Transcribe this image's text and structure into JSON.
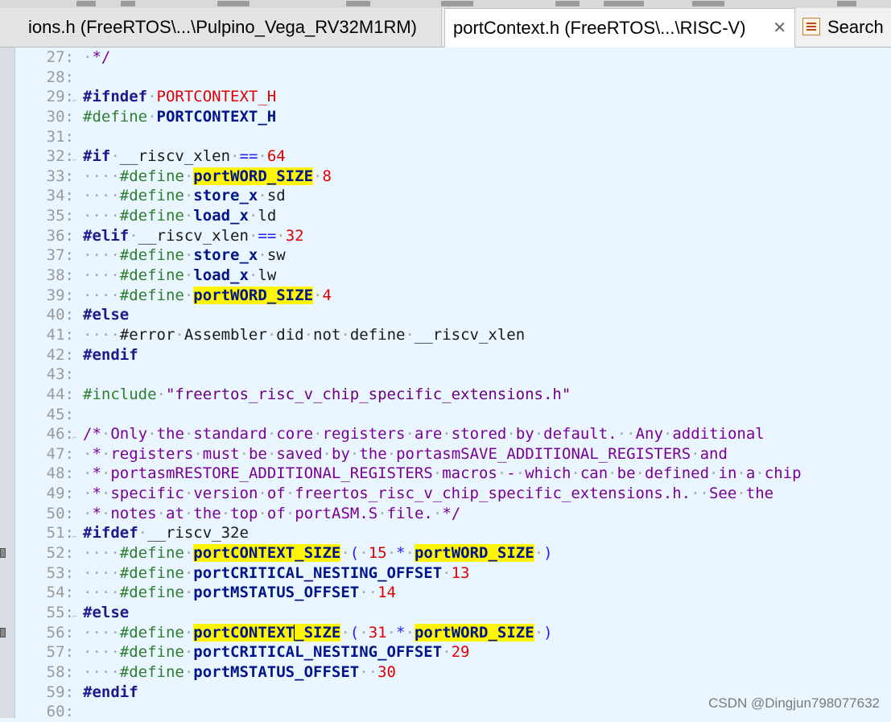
{
  "tabs": {
    "left_title": "ions.h (FreeRTOS\\...\\Pulpino_Vega_RV32M1RM)",
    "active_title": "portContext.h (FreeRTOS\\...\\RISC-V)",
    "close_glyph": "✕",
    "search_label": "Search"
  },
  "lines": [
    {
      "n": "27:",
      "segs": [
        [
          "dot",
          "·"
        ],
        [
          "cmt",
          "*/"
        ]
      ]
    },
    {
      "n": "28:",
      "segs": []
    },
    {
      "n": "29:",
      "fold": true,
      "segs": [
        [
          "pp",
          "#ifndef"
        ],
        [
          "dot",
          "·"
        ],
        [
          "red",
          "PORTCONTEXT_H"
        ]
      ]
    },
    {
      "n": "30:",
      "segs": [
        [
          "def",
          "#define"
        ],
        [
          "dot",
          "·"
        ],
        [
          "mac",
          "PORTCONTEXT_H"
        ]
      ]
    },
    {
      "n": "31:",
      "segs": []
    },
    {
      "n": "32:",
      "fold": true,
      "segs": [
        [
          "pp",
          "#if"
        ],
        [
          "dot",
          "·"
        ],
        [
          "plain",
          "__riscv_xlen"
        ],
        [
          "dot",
          "·"
        ],
        [
          "op",
          "=="
        ],
        [
          "dot",
          "·"
        ],
        [
          "num",
          "64"
        ]
      ]
    },
    {
      "n": "33:",
      "segs": [
        [
          "dot",
          "····"
        ],
        [
          "def",
          "#define"
        ],
        [
          "dot",
          "·"
        ],
        [
          "mac hl",
          "portWORD_SIZE"
        ],
        [
          "dot",
          "·"
        ],
        [
          "num",
          "8"
        ]
      ]
    },
    {
      "n": "34:",
      "segs": [
        [
          "dot",
          "····"
        ],
        [
          "def",
          "#define"
        ],
        [
          "dot",
          "·"
        ],
        [
          "mac",
          "store_x"
        ],
        [
          "dot",
          "·"
        ],
        [
          "plain",
          "sd"
        ]
      ]
    },
    {
      "n": "35:",
      "segs": [
        [
          "dot",
          "····"
        ],
        [
          "def",
          "#define"
        ],
        [
          "dot",
          "·"
        ],
        [
          "mac",
          "load_x"
        ],
        [
          "dot",
          "·"
        ],
        [
          "plain",
          "ld"
        ]
      ]
    },
    {
      "n": "36:",
      "segs": [
        [
          "pp",
          "#elif"
        ],
        [
          "dot",
          "·"
        ],
        [
          "plain",
          "__riscv_xlen"
        ],
        [
          "dot",
          "·"
        ],
        [
          "op",
          "=="
        ],
        [
          "dot",
          "·"
        ],
        [
          "num",
          "32"
        ]
      ]
    },
    {
      "n": "37:",
      "segs": [
        [
          "dot",
          "····"
        ],
        [
          "def",
          "#define"
        ],
        [
          "dot",
          "·"
        ],
        [
          "mac",
          "store_x"
        ],
        [
          "dot",
          "·"
        ],
        [
          "plain",
          "sw"
        ]
      ]
    },
    {
      "n": "38:",
      "segs": [
        [
          "dot",
          "····"
        ],
        [
          "def",
          "#define"
        ],
        [
          "dot",
          "·"
        ],
        [
          "mac",
          "load_x"
        ],
        [
          "dot",
          "·"
        ],
        [
          "plain",
          "lw"
        ]
      ]
    },
    {
      "n": "39:",
      "segs": [
        [
          "dot",
          "····"
        ],
        [
          "def",
          "#define"
        ],
        [
          "dot",
          "·"
        ],
        [
          "mac hl",
          "portWORD_SIZE"
        ],
        [
          "dot",
          "·"
        ],
        [
          "num",
          "4"
        ]
      ]
    },
    {
      "n": "40:",
      "segs": [
        [
          "pp",
          "#else"
        ]
      ]
    },
    {
      "n": "41:",
      "segs": [
        [
          "dot",
          "····"
        ],
        [
          "plain",
          "#error"
        ],
        [
          "dot",
          "·"
        ],
        [
          "plain",
          "Assembler"
        ],
        [
          "dot",
          "·"
        ],
        [
          "plain",
          "did"
        ],
        [
          "dot",
          "·"
        ],
        [
          "plain",
          "not"
        ],
        [
          "dot",
          "·"
        ],
        [
          "plain",
          "define"
        ],
        [
          "dot",
          "·"
        ],
        [
          "plain",
          "__riscv_xlen"
        ]
      ]
    },
    {
      "n": "42:",
      "segs": [
        [
          "pp",
          "#endif"
        ]
      ]
    },
    {
      "n": "43:",
      "segs": []
    },
    {
      "n": "44:",
      "segs": [
        [
          "def",
          "#include"
        ],
        [
          "dot",
          "·"
        ],
        [
          "str",
          "\"freertos_risc_v_chip_specific_extensions.h\""
        ]
      ]
    },
    {
      "n": "45:",
      "segs": []
    },
    {
      "n": "46:",
      "fold": true,
      "segs": [
        [
          "cmt",
          "/*"
        ],
        [
          "dot",
          "·"
        ],
        [
          "cmt",
          "Only"
        ],
        [
          "dot",
          "·"
        ],
        [
          "cmt",
          "the"
        ],
        [
          "dot",
          "·"
        ],
        [
          "cmt",
          "standard"
        ],
        [
          "dot",
          "·"
        ],
        [
          "cmt",
          "core"
        ],
        [
          "dot",
          "·"
        ],
        [
          "cmt",
          "registers"
        ],
        [
          "dot",
          "·"
        ],
        [
          "cmt",
          "are"
        ],
        [
          "dot",
          "·"
        ],
        [
          "cmt",
          "stored"
        ],
        [
          "dot",
          "·"
        ],
        [
          "cmt",
          "by"
        ],
        [
          "dot",
          "·"
        ],
        [
          "cmt",
          "default."
        ],
        [
          "dot",
          "··"
        ],
        [
          "cmt",
          "Any"
        ],
        [
          "dot",
          "·"
        ],
        [
          "cmt",
          "additional"
        ]
      ]
    },
    {
      "n": "47:",
      "segs": [
        [
          "dot",
          "·"
        ],
        [
          "cmt",
          "*"
        ],
        [
          "dot",
          "·"
        ],
        [
          "cmt",
          "registers"
        ],
        [
          "dot",
          "·"
        ],
        [
          "cmt",
          "must"
        ],
        [
          "dot",
          "·"
        ],
        [
          "cmt",
          "be"
        ],
        [
          "dot",
          "·"
        ],
        [
          "cmt",
          "saved"
        ],
        [
          "dot",
          "·"
        ],
        [
          "cmt",
          "by"
        ],
        [
          "dot",
          "·"
        ],
        [
          "cmt",
          "the"
        ],
        [
          "dot",
          "·"
        ],
        [
          "cmt",
          "portasmSAVE_ADDITIONAL_REGISTERS"
        ],
        [
          "dot",
          "·"
        ],
        [
          "cmt",
          "and"
        ]
      ]
    },
    {
      "n": "48:",
      "segs": [
        [
          "dot",
          "·"
        ],
        [
          "cmt",
          "*"
        ],
        [
          "dot",
          "·"
        ],
        [
          "cmt",
          "portasmRESTORE_ADDITIONAL_REGISTERS"
        ],
        [
          "dot",
          "·"
        ],
        [
          "cmt",
          "macros"
        ],
        [
          "dot",
          "·"
        ],
        [
          "cmt",
          "-"
        ],
        [
          "dot",
          "·"
        ],
        [
          "cmt",
          "which"
        ],
        [
          "dot",
          "·"
        ],
        [
          "cmt",
          "can"
        ],
        [
          "dot",
          "·"
        ],
        [
          "cmt",
          "be"
        ],
        [
          "dot",
          "·"
        ],
        [
          "cmt",
          "defined"
        ],
        [
          "dot",
          "·"
        ],
        [
          "cmt",
          "in"
        ],
        [
          "dot",
          "·"
        ],
        [
          "cmt",
          "a"
        ],
        [
          "dot",
          "·"
        ],
        [
          "cmt",
          "chip"
        ]
      ]
    },
    {
      "n": "49:",
      "segs": [
        [
          "dot",
          "·"
        ],
        [
          "cmt",
          "*"
        ],
        [
          "dot",
          "·"
        ],
        [
          "cmt",
          "specific"
        ],
        [
          "dot",
          "·"
        ],
        [
          "cmt",
          "version"
        ],
        [
          "dot",
          "·"
        ],
        [
          "cmt",
          "of"
        ],
        [
          "dot",
          "·"
        ],
        [
          "cmt",
          "freertos_risc_v_chip_specific_extensions.h."
        ],
        [
          "dot",
          "··"
        ],
        [
          "cmt",
          "See"
        ],
        [
          "dot",
          "·"
        ],
        [
          "cmt",
          "the"
        ]
      ]
    },
    {
      "n": "50:",
      "segs": [
        [
          "dot",
          "·"
        ],
        [
          "cmt",
          "*"
        ],
        [
          "dot",
          "·"
        ],
        [
          "cmt",
          "notes"
        ],
        [
          "dot",
          "·"
        ],
        [
          "cmt",
          "at"
        ],
        [
          "dot",
          "·"
        ],
        [
          "cmt",
          "the"
        ],
        [
          "dot",
          "·"
        ],
        [
          "cmt",
          "top"
        ],
        [
          "dot",
          "·"
        ],
        [
          "cmt",
          "of"
        ],
        [
          "dot",
          "·"
        ],
        [
          "cmt",
          "portASM.S"
        ],
        [
          "dot",
          "·"
        ],
        [
          "cmt",
          "file."
        ],
        [
          "dot",
          "·"
        ],
        [
          "cmt",
          "*/"
        ]
      ]
    },
    {
      "n": "51:",
      "fold": true,
      "segs": [
        [
          "pp",
          "#ifdef"
        ],
        [
          "dot",
          "·"
        ],
        [
          "plain",
          "__riscv_32e"
        ]
      ]
    },
    {
      "n": "52:",
      "bookmark": true,
      "segs": [
        [
          "dot",
          "····"
        ],
        [
          "def",
          "#define"
        ],
        [
          "dot",
          "·"
        ],
        [
          "mac hl",
          "portCONTEXT_SIZE"
        ],
        [
          "dot",
          "·"
        ],
        [
          "op",
          "("
        ],
        [
          "dot",
          "·"
        ],
        [
          "num",
          "15"
        ],
        [
          "dot",
          "·"
        ],
        [
          "op",
          "*"
        ],
        [
          "dot",
          "·"
        ],
        [
          "mac hl",
          "portWORD_SIZE"
        ],
        [
          "dot",
          "·"
        ],
        [
          "op",
          ")"
        ]
      ]
    },
    {
      "n": "53:",
      "segs": [
        [
          "dot",
          "····"
        ],
        [
          "def",
          "#define"
        ],
        [
          "dot",
          "·"
        ],
        [
          "mac",
          "portCRITICAL_NESTING_OFFSET"
        ],
        [
          "dot",
          "·"
        ],
        [
          "num",
          "13"
        ]
      ]
    },
    {
      "n": "54:",
      "segs": [
        [
          "dot",
          "····"
        ],
        [
          "def",
          "#define"
        ],
        [
          "dot",
          "·"
        ],
        [
          "mac",
          "portMSTATUS_OFFSET"
        ],
        [
          "dot",
          "··"
        ],
        [
          "num",
          "14"
        ]
      ]
    },
    {
      "n": "55:",
      "fold": true,
      "segs": [
        [
          "pp",
          "#else"
        ]
      ]
    },
    {
      "n": "56:",
      "bookmark": true,
      "segs": [
        [
          "dot",
          "····"
        ],
        [
          "def",
          "#define"
        ],
        [
          "dot",
          "·"
        ],
        [
          "mac hl",
          "portCONTEXT"
        ],
        [
          "caret",
          ""
        ],
        [
          "mac hl",
          "_SIZE"
        ],
        [
          "dot",
          "·"
        ],
        [
          "op",
          "("
        ],
        [
          "dot",
          "·"
        ],
        [
          "num",
          "31"
        ],
        [
          "dot",
          "·"
        ],
        [
          "op",
          "*"
        ],
        [
          "dot",
          "·"
        ],
        [
          "mac hl",
          "portWORD_SIZE"
        ],
        [
          "dot",
          "·"
        ],
        [
          "op",
          ")"
        ]
      ]
    },
    {
      "n": "57:",
      "segs": [
        [
          "dot",
          "····"
        ],
        [
          "def",
          "#define"
        ],
        [
          "dot",
          "·"
        ],
        [
          "mac",
          "portCRITICAL_NESTING_OFFSET"
        ],
        [
          "dot",
          "·"
        ],
        [
          "num",
          "29"
        ]
      ]
    },
    {
      "n": "58:",
      "segs": [
        [
          "dot",
          "····"
        ],
        [
          "def",
          "#define"
        ],
        [
          "dot",
          "·"
        ],
        [
          "mac",
          "portMSTATUS_OFFSET"
        ],
        [
          "dot",
          "··"
        ],
        [
          "num",
          "30"
        ]
      ]
    },
    {
      "n": "59:",
      "segs": [
        [
          "pp",
          "#endif"
        ]
      ]
    },
    {
      "n": "60:",
      "segs": []
    }
  ],
  "watermark": "CSDN @Dingjun798077632"
}
